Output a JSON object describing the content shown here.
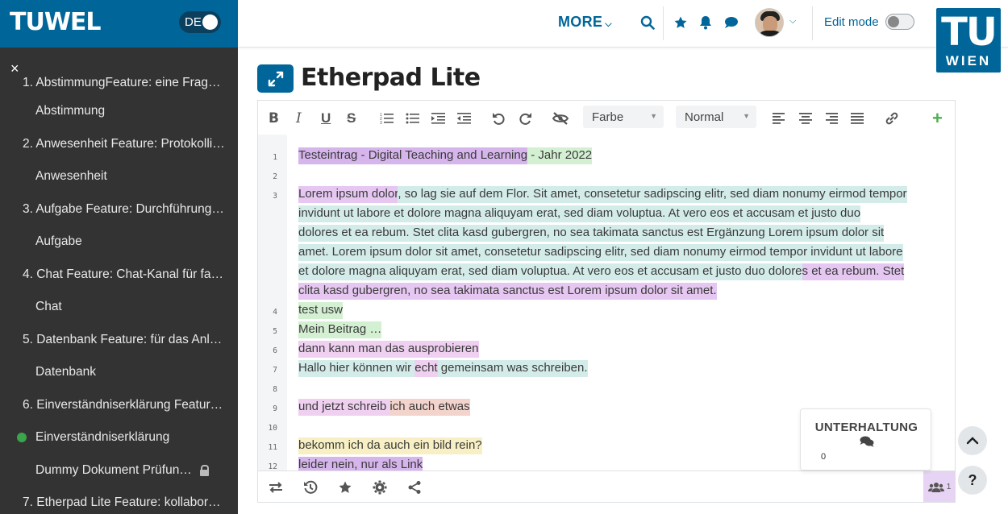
{
  "brand": {
    "logo_text": "TUWEL",
    "lang": "DE"
  },
  "header": {
    "more_label": "MORE",
    "edit_mode_label": "Edit mode",
    "tu_logo_top": "TU",
    "tu_logo_bottom": "WIEN"
  },
  "sidebar": {
    "close_label": "×",
    "items": [
      {
        "label": "1. AbstimmungFeature: eine Frag…",
        "kind": "section"
      },
      {
        "label": "Abstimmung",
        "kind": "sub"
      },
      {
        "label": "2. Anwesenheit Feature: Protokolli…",
        "kind": "section"
      },
      {
        "label": "Anwesenheit",
        "kind": "sub"
      },
      {
        "label": "3. Aufgabe Feature: Durchführung…",
        "kind": "section"
      },
      {
        "label": "Aufgabe",
        "kind": "sub"
      },
      {
        "label": "4. Chat Feature: Chat-Kanal für fa…",
        "kind": "section"
      },
      {
        "label": "Chat",
        "kind": "sub"
      },
      {
        "label": "5. Datenbank Feature: für das Anl…",
        "kind": "section"
      },
      {
        "label": "Datenbank",
        "kind": "sub"
      },
      {
        "label": "6. Einverständniserklärung Featur…",
        "kind": "section"
      },
      {
        "label": "Einverständniserklärung",
        "kind": "sub",
        "completed": true
      },
      {
        "label": "Dummy Dokument Prüfun…",
        "kind": "sub",
        "locked": true
      },
      {
        "label": "7. Etherpad Lite Feature: kollabor…",
        "kind": "section"
      }
    ]
  },
  "page": {
    "title": "Etherpad Lite"
  },
  "pad": {
    "toolbar": {
      "color_select": "Farbe",
      "style_select": "Normal"
    },
    "lines": [
      {
        "num": "1",
        "segments": [
          {
            "text": "Testeintrag - Digital Teaching and Learning",
            "color": "purple"
          },
          {
            "text": " - Jahr 2022",
            "color": "green"
          }
        ]
      },
      {
        "num": "2",
        "segments": []
      },
      {
        "num": "3",
        "segments": [
          {
            "text": "Lorem ipsum dolor",
            "color": "violet"
          },
          {
            "text": ", so lag sie auf dem Flor. Sit amet, consetetur sadipscing elitr, sed diam nonumy eirmod tempor",
            "color": "teal"
          }
        ]
      },
      {
        "num": "",
        "segments": [
          {
            "text": "invidunt ut labore et dolore magna aliquyam erat, sed diam voluptua. At vero eos et accusam et justo duo",
            "color": "teal"
          }
        ]
      },
      {
        "num": "",
        "segments": [
          {
            "text": "dolores et ea rebum. Stet clita kasd gubergren, no sea takimata sanctus est Ergänzung Lorem ipsum dolor sit",
            "color": "teal"
          }
        ]
      },
      {
        "num": "",
        "segments": [
          {
            "text": "amet. Lorem ipsum dolor sit amet, consetetur sadipscing elitr, sed diam nonumy eirmod tempor invidunt ut labore",
            "color": "teal"
          }
        ]
      },
      {
        "num": "",
        "segments": [
          {
            "text": "et dolore magna aliquyam erat, sed diam voluptua. At vero eos et accusam et justo duo dolore",
            "color": "teal"
          },
          {
            "text": "s et ea rebum. Stet",
            "color": "violet"
          }
        ]
      },
      {
        "num": "",
        "segments": [
          {
            "text": "clita kasd gubergren, no sea takimata sanctus est Lorem ipsum dolor sit amet.",
            "color": "violet"
          }
        ]
      },
      {
        "num": "4",
        "segments": [
          {
            "text": "test usw",
            "color": "green"
          }
        ]
      },
      {
        "num": "5",
        "segments": [
          {
            "text": "Mein Bei",
            "color": "green"
          },
          {
            "text": "trag …",
            "color": "green"
          }
        ]
      },
      {
        "num": "6",
        "segments": [
          {
            "text": "dann kann man das ausprobieren",
            "color": "pink"
          }
        ]
      },
      {
        "num": "7",
        "segments": [
          {
            "text": "Hallo hier können wir ",
            "color": "teal"
          },
          {
            "text": "echt",
            "color": "pink"
          },
          {
            "text": " gemeinsam was schreiben.",
            "color": "teal"
          }
        ]
      },
      {
        "num": "8",
        "segments": []
      },
      {
        "num": "9",
        "segments": [
          {
            "text": "und jetzt schreib ",
            "color": "pink"
          },
          {
            "text": "ich auch etwas",
            "color": "orange"
          }
        ]
      },
      {
        "num": "10",
        "segments": []
      },
      {
        "num": "11",
        "segments": [
          {
            "text": "bekomm ich da auch ein bild rein?",
            "color": "yellow"
          }
        ]
      },
      {
        "num": "12",
        "segments": [
          {
            "text": "leider nein, nur als Link",
            "color": "purple"
          }
        ]
      }
    ],
    "users_count": "1"
  },
  "chat": {
    "title": "UNTERHALTUNG",
    "count": "0"
  },
  "colors": {
    "brand": "#006699",
    "sidebar_bg": "#333333",
    "author_purple": "#d6b5ec",
    "author_green": "#d4f0d2",
    "author_teal": "#d3ece9",
    "author_pink": "#efd0f1",
    "author_orange": "#f3d4cc",
    "author_yellow": "#f8f0c4"
  }
}
